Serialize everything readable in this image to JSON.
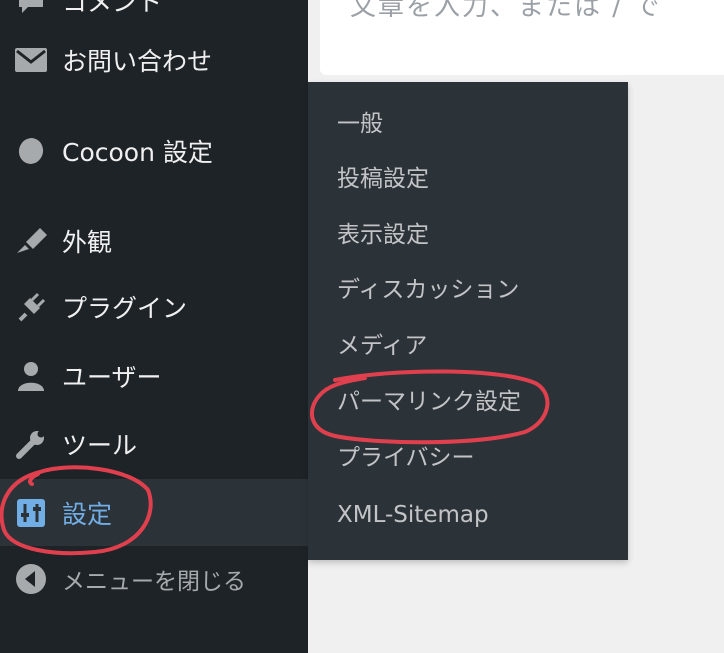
{
  "content": {
    "partial_text": "文章を入力、または / で"
  },
  "sidebar": {
    "items": [
      {
        "name": "comments",
        "label": "コメント",
        "icon": "comment-icon"
      },
      {
        "name": "contact",
        "label": "お問い合わせ",
        "icon": "mail-icon"
      },
      {
        "name": "cocoon-settings",
        "label": "Cocoon 設定",
        "icon": "cocoon-icon"
      },
      {
        "name": "appearance",
        "label": "外観",
        "icon": "brush-icon"
      },
      {
        "name": "plugins",
        "label": "プラグイン",
        "icon": "plugin-icon"
      },
      {
        "name": "users",
        "label": "ユーザー",
        "icon": "user-icon"
      },
      {
        "name": "tools",
        "label": "ツール",
        "icon": "wrench-icon"
      },
      {
        "name": "settings",
        "label": "設定",
        "icon": "settings-sliders-icon",
        "current": true
      }
    ],
    "collapse_label": "メニューを閉じる"
  },
  "submenu": {
    "items": [
      {
        "label": "一般"
      },
      {
        "label": "投稿設定"
      },
      {
        "label": "表示設定"
      },
      {
        "label": "ディスカッション"
      },
      {
        "label": "メディア"
      },
      {
        "label": "パーマリンク設定",
        "highlighted": true
      },
      {
        "label": "プライバシー"
      },
      {
        "label": "XML-Sitemap"
      }
    ]
  },
  "colors": {
    "sidebar_bg": "#1d2327",
    "flyout_bg": "#2c3338",
    "active_text": "#72aee6",
    "annotation": "#e0404e"
  }
}
